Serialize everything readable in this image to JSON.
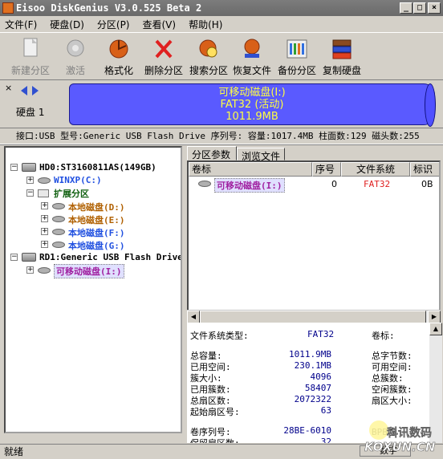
{
  "title": "Eisoo DiskGenius V3.0.525 Beta 2",
  "menu": [
    "文件(F)",
    "硬盘(D)",
    "分区(P)",
    "查看(V)",
    "帮助(H)"
  ],
  "toolbar": [
    {
      "label": "新建分区",
      "icon": "new-partition-icon",
      "enabled": false
    },
    {
      "label": "激活",
      "icon": "activate-icon",
      "enabled": false
    },
    {
      "label": "格式化",
      "icon": "format-icon",
      "enabled": true
    },
    {
      "label": "删除分区",
      "icon": "delete-partition-icon",
      "enabled": true
    },
    {
      "label": "搜索分区",
      "icon": "search-partition-icon",
      "enabled": true
    },
    {
      "label": "恢复文件",
      "icon": "recover-file-icon",
      "enabled": true
    },
    {
      "label": "备份分区",
      "icon": "backup-partition-icon",
      "enabled": true
    },
    {
      "label": "复制硬盘",
      "icon": "copy-disk-icon",
      "enabled": true
    }
  ],
  "disk_bar": {
    "disk_label": "硬盘",
    "disk_index": "1",
    "partition_name": "可移动磁盘(I:)",
    "fs": "FAT32 (活动)",
    "size": "1011.9MB"
  },
  "info_line": "接口:USB  型号:Generic USB Flash Drive  序列号:  容量:1017.4MB  柱面数:129  磁头数:255",
  "tree": {
    "hd0": "HD0:ST3160811AS(149GB)",
    "c": "WINXP(C:)",
    "ext": "扩展分区",
    "d": "本地磁盘(D:)",
    "e": "本地磁盘(E:)",
    "f": "本地磁盘(F:)",
    "g": "本地磁盘(G:)",
    "rd1": "RD1:Generic USB Flash Drive",
    "i": "可移动磁盘(I:)"
  },
  "tabs": [
    "分区参数",
    "浏览文件"
  ],
  "list": {
    "headers": [
      "卷标",
      "序号",
      "文件系统",
      "标识"
    ],
    "rows": [
      {
        "label": "可移动磁盘(I:)",
        "index": "0",
        "fs": "FAT32",
        "id": "0B"
      }
    ]
  },
  "props": {
    "fs_type_label": "文件系统类型:",
    "fs_type": "FAT32",
    "vol_label": "卷标:",
    "left": [
      {
        "k": "总容量:",
        "v": "1011.9MB"
      },
      {
        "k": "已用空间:",
        "v": "230.1MB"
      },
      {
        "k": "簇大小:",
        "v": "4096"
      },
      {
        "k": "已用簇数:",
        "v": "58407"
      },
      {
        "k": "总扇区数:",
        "v": "2072322"
      },
      {
        "k": "起始扇区号:",
        "v": "63"
      }
    ],
    "right": [
      "总字节数:",
      "可用空间:",
      "总簇数:",
      "空闲簇数:",
      "扇区大小:"
    ],
    "serial_label": "卷序列号:",
    "serial": "28BE-6010",
    "reserved_label": "保留扇区数:",
    "reserved": "32",
    "bpb_label": "BPB卷"
  },
  "status": {
    "text": "就绪",
    "num": "数字"
  },
  "watermark": {
    "line1": "科讯数码",
    "line2": "KOXUN.CN"
  }
}
